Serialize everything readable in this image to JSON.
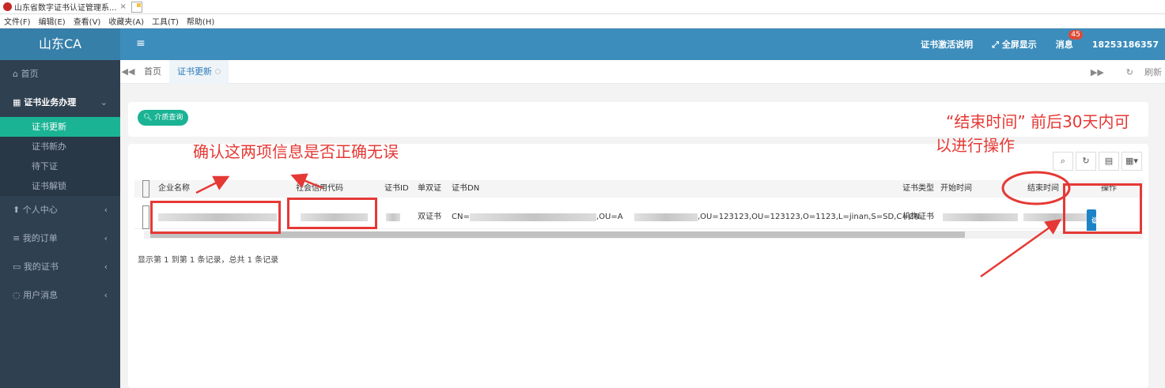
{
  "browser": {
    "tab_title": "山东省数字证书认证管理系...",
    "tab_close": "×",
    "menu": [
      "文件(F)",
      "编辑(E)",
      "查看(V)",
      "收藏夹(A)",
      "工具(T)",
      "帮助(H)"
    ]
  },
  "header": {
    "logo": "山东CA",
    "menu_toggle": "≡",
    "activation_help": "证书激活说明",
    "fullscreen": "全屏显示",
    "messages": "消息",
    "message_count": "45",
    "user": "18253186357"
  },
  "sidebar": {
    "home": "首页",
    "group": "证书业务办理",
    "sub_items": [
      "证书更新",
      "证书新办",
      "待下证",
      "证书解锁"
    ],
    "items": [
      "个人中心",
      "我的订单",
      "我的证书",
      "用户消息"
    ]
  },
  "tabs": {
    "home": "首页",
    "current": "证书更新",
    "refresh": "刷新"
  },
  "search": {
    "button": "介质查询"
  },
  "table": {
    "columns": [
      "企业名称",
      "社会信用代码",
      "证书ID",
      "单双证",
      "证书DN",
      "证书类型",
      "开始时间",
      "结束时间",
      "操作"
    ],
    "row": {
      "cert_kind": "双证书",
      "dn_prefix": "CN=",
      "dn_mid": ",OU=A",
      "dn_suffix": ",OU=123123,OU=123123,O=1123,L=jinan,S=SD,C=CN",
      "cert_type": "机构证书",
      "action": "证书延期"
    },
    "summary": "显示第 1 到第 1 条记录，总共 1 条记录"
  },
  "annotations": {
    "confirm": "确认这两项信息是否正确无误",
    "end_time_line1": "“结束时间” 前后30天内可",
    "end_time_line2": "以进行操作"
  },
  "colors": {
    "header": "#3c8dbc",
    "sidebar": "#2f4050",
    "accent": "#1ab394",
    "button": "#1c84c6",
    "annotation": "#e53935"
  }
}
